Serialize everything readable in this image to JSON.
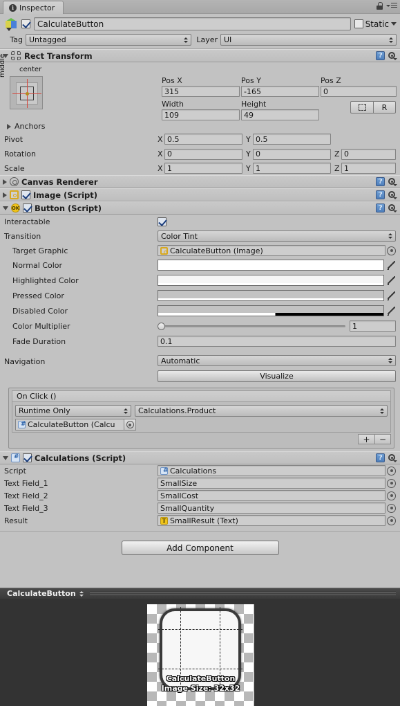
{
  "window": {
    "tab_label": "Inspector",
    "tab_icon": "info-icon",
    "lock_icon": "lock-icon",
    "menu_icon": "hamburger-menu-icon"
  },
  "header": {
    "active_checkbox": true,
    "object_name": "CalculateButton",
    "static_label": "Static",
    "static_checked": false,
    "tag_label": "Tag",
    "tag_value": "Untagged",
    "layer_label": "Layer",
    "layer_value": "UI"
  },
  "rect_transform": {
    "title": "Rect Transform",
    "anchor_preset_h": "center",
    "anchor_preset_v": "middle",
    "fields": [
      {
        "label": "Pos X",
        "value": "315"
      },
      {
        "label": "Pos Y",
        "value": "-165"
      },
      {
        "label": "Pos Z",
        "value": "0"
      },
      {
        "label": "Width",
        "value": "109"
      },
      {
        "label": "Height",
        "value": "49"
      }
    ],
    "blueprint_button": "blueprint-mode-icon",
    "raw_button": "R",
    "anchors_label": "Anchors",
    "pivot": {
      "label": "Pivot",
      "x_label": "X",
      "x": "0.5",
      "y_label": "Y",
      "y": "0.5"
    },
    "rotation": {
      "label": "Rotation",
      "x_label": "X",
      "x": "0",
      "y_label": "Y",
      "y": "0",
      "z_label": "Z",
      "z": "0"
    },
    "scale": {
      "label": "Scale",
      "x_label": "X",
      "x": "1",
      "y_label": "Y",
      "y": "1",
      "z_label": "Z",
      "z": "1"
    }
  },
  "canvas_renderer": {
    "title": "Canvas Renderer"
  },
  "image_component": {
    "title": "Image (Script)",
    "enabled": true
  },
  "button_component": {
    "title": "Button (Script)",
    "enabled": true,
    "interactable_label": "Interactable",
    "interactable_checked": true,
    "transition_label": "Transition",
    "transition_value": "Color Tint",
    "target_graphic_label": "Target Graphic",
    "target_graphic_value": "CalculateButton (Image)",
    "colors": [
      {
        "label": "Normal Color",
        "hex": "#FFFFFF",
        "alpha": 1.0
      },
      {
        "label": "Highlighted Color",
        "hex": "#F5F5F5",
        "alpha": 1.0
      },
      {
        "label": "Pressed Color",
        "hex": "#C8C8C8",
        "alpha": 1.0
      },
      {
        "label": "Disabled Color",
        "hex": "#C8C8C8",
        "alpha": 0.5
      }
    ],
    "color_multiplier_label": "Color Multiplier",
    "color_multiplier_value": "1",
    "color_multiplier_pct": 0,
    "fade_duration_label": "Fade Duration",
    "fade_duration_value": "0.1",
    "navigation_label": "Navigation",
    "navigation_value": "Automatic",
    "visualize_label": "Visualize",
    "on_click": {
      "title": "On Click ()",
      "entries": [
        {
          "mode": "Runtime Only",
          "function": "Calculations.Product",
          "object": "CalculateButton (Calcu"
        }
      ],
      "add_label": "+",
      "remove_label": "−"
    }
  },
  "calculations_component": {
    "title": "Calculations (Script)",
    "enabled": true,
    "rows": [
      {
        "label": "Script",
        "value": "Calculations",
        "icon": "csharp-script-icon"
      },
      {
        "label": "Text Field_1",
        "value": "SmallSize",
        "icon": ""
      },
      {
        "label": "Text Field_2",
        "value": "SmallCost",
        "icon": ""
      },
      {
        "label": "Text Field_3",
        "value": "SmallQuantity",
        "icon": ""
      },
      {
        "label": "Result",
        "value": "SmallResult (Text)",
        "icon": "text-component-icon"
      }
    ]
  },
  "add_component": {
    "label": "Add Component"
  },
  "preview": {
    "title": "CalculateButton",
    "asset_name": "CalculateButton",
    "size_label": "Image Size: 32x32"
  },
  "colors": {
    "panel_bg": "#C2C2C2",
    "field_bg": "#CDCDCD",
    "preview_bg": "#333333",
    "accent_yellow": "#F0C419",
    "accent_blue": "#4E7FBB"
  }
}
